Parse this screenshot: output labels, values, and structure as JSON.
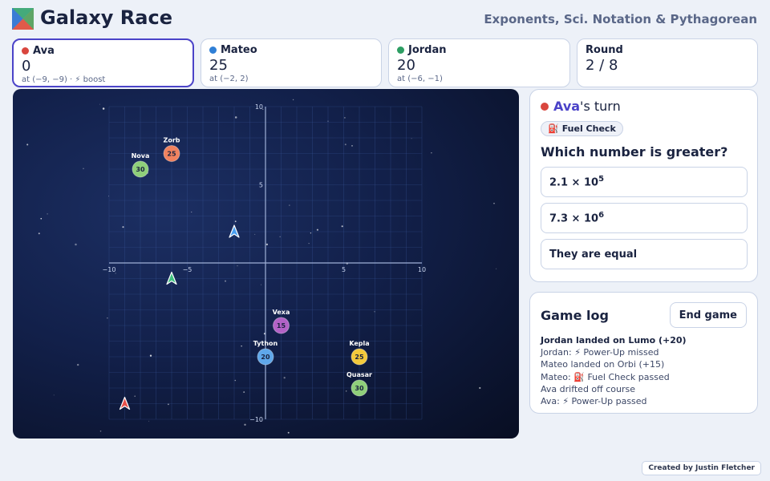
{
  "app": {
    "title": "Galaxy Race",
    "subtitle": "Exponents, Sci. Notation & Pythagorean"
  },
  "players": [
    {
      "name": "Ava",
      "score": "0",
      "position": "at (−9, −9) · ⚡ boost",
      "color": "#d9463e",
      "active": true
    },
    {
      "name": "Mateo",
      "score": "25",
      "position": "at (−2, 2)",
      "color": "#2f7fd6",
      "active": false
    },
    {
      "name": "Jordan",
      "score": "20",
      "position": "at (−6, −1)",
      "color": "#2d9e63",
      "active": false
    }
  ],
  "round": {
    "label": "Round",
    "value": "2 / 8"
  },
  "board": {
    "axis_ticks": {
      "x": [
        "−10",
        "−5",
        "5",
        "10"
      ],
      "y": [
        "10",
        "5",
        "−10"
      ]
    },
    "planets": [
      {
        "name": "Zorb",
        "points": "25",
        "x": -6,
        "y": 7,
        "color": "#f0825f"
      },
      {
        "name": "Nova",
        "points": "30",
        "x": -8,
        "y": 6,
        "color": "#8fcf7a"
      },
      {
        "name": "Vexa",
        "points": "15",
        "x": 1,
        "y": -4,
        "color": "#b262c6"
      },
      {
        "name": "Tython",
        "points": "20",
        "x": 0,
        "y": -6,
        "color": "#5fa7ea"
      },
      {
        "name": "Kepla",
        "points": "25",
        "x": 6,
        "y": -6,
        "color": "#f3c93b"
      },
      {
        "name": "Quasar",
        "points": "30",
        "x": 6,
        "y": -8,
        "color": "#8fcf7a"
      }
    ],
    "ships": [
      {
        "player": "Mateo",
        "x": -2,
        "y": 2,
        "color": "#4a9ff0"
      },
      {
        "player": "Jordan",
        "x": -6,
        "y": -1,
        "color": "#3fc27f"
      },
      {
        "player": "Ava",
        "x": -9,
        "y": -9,
        "color": "#e8504a"
      }
    ]
  },
  "turn": {
    "player": "Ava",
    "suffix": "'s turn",
    "dot_color": "#d9463e",
    "badge": "Fuel Check",
    "badge_icon": "⛽",
    "question": "Which number is greater?",
    "options": [
      {
        "mantissa": "2.1 × 10",
        "exp": "5"
      },
      {
        "mantissa": "7.3 × 10",
        "exp": "6"
      },
      {
        "mantissa": "They are equal",
        "exp": ""
      }
    ]
  },
  "log": {
    "title": "Game log",
    "end_button": "End game",
    "entries": [
      "Jordan landed on Lumo (+20)",
      "Jordan: ⚡ Power-Up missed",
      "Mateo landed on Orbi (+15)",
      "Mateo: ⛽ Fuel Check passed",
      "Ava drifted off course",
      "Ava: ⚡ Power-Up passed"
    ]
  },
  "credit": "Created by Justin Fletcher"
}
